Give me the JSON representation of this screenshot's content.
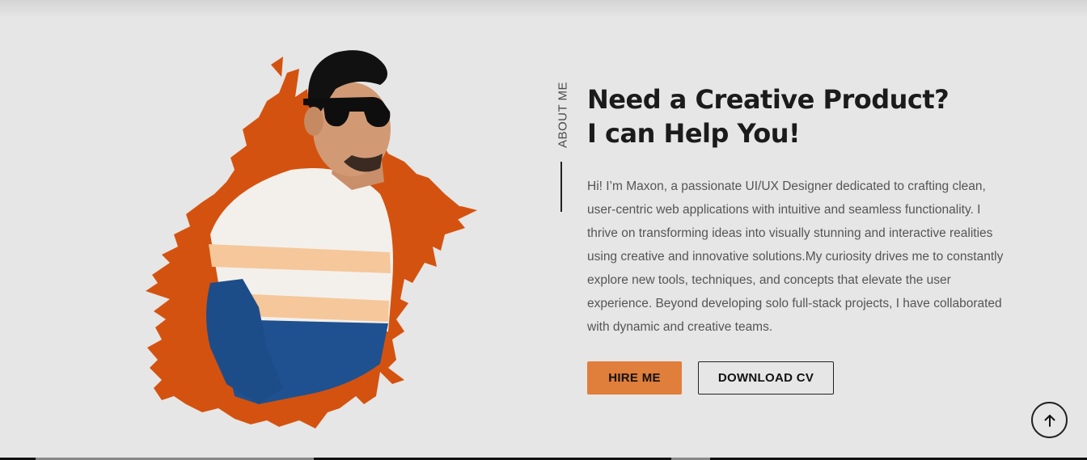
{
  "about": {
    "label": "ABOUT ME",
    "heading_line1": "Need a Creative Product?",
    "heading_line2": "I can Help You!",
    "bio": "Hi! I’m Maxon, a passionate UI/UX Designer dedicated to crafting clean, user-centric web applications with intuitive and seamless functionality. I thrive on transforming ideas into visually stunning and interactive realities using creative and innovative solutions.My curiosity drives me to constantly explore new tools, techniques, and concepts that elevate the user experience. Beyond developing solo full-stack projects, I have collaborated with dynamic and creative teams."
  },
  "buttons": {
    "hire_label": "HIRE ME",
    "cv_label": "DOWNLOAD CV"
  },
  "icons": {
    "portrait": "person-portrait-illustration",
    "scroll_top": "arrow-up-icon"
  },
  "colors": {
    "background": "#e6e6e6",
    "accent": "#e07e3c",
    "brush": "#d4520f",
    "text_dark": "#1b1b1b",
    "text_body": "#555555"
  }
}
